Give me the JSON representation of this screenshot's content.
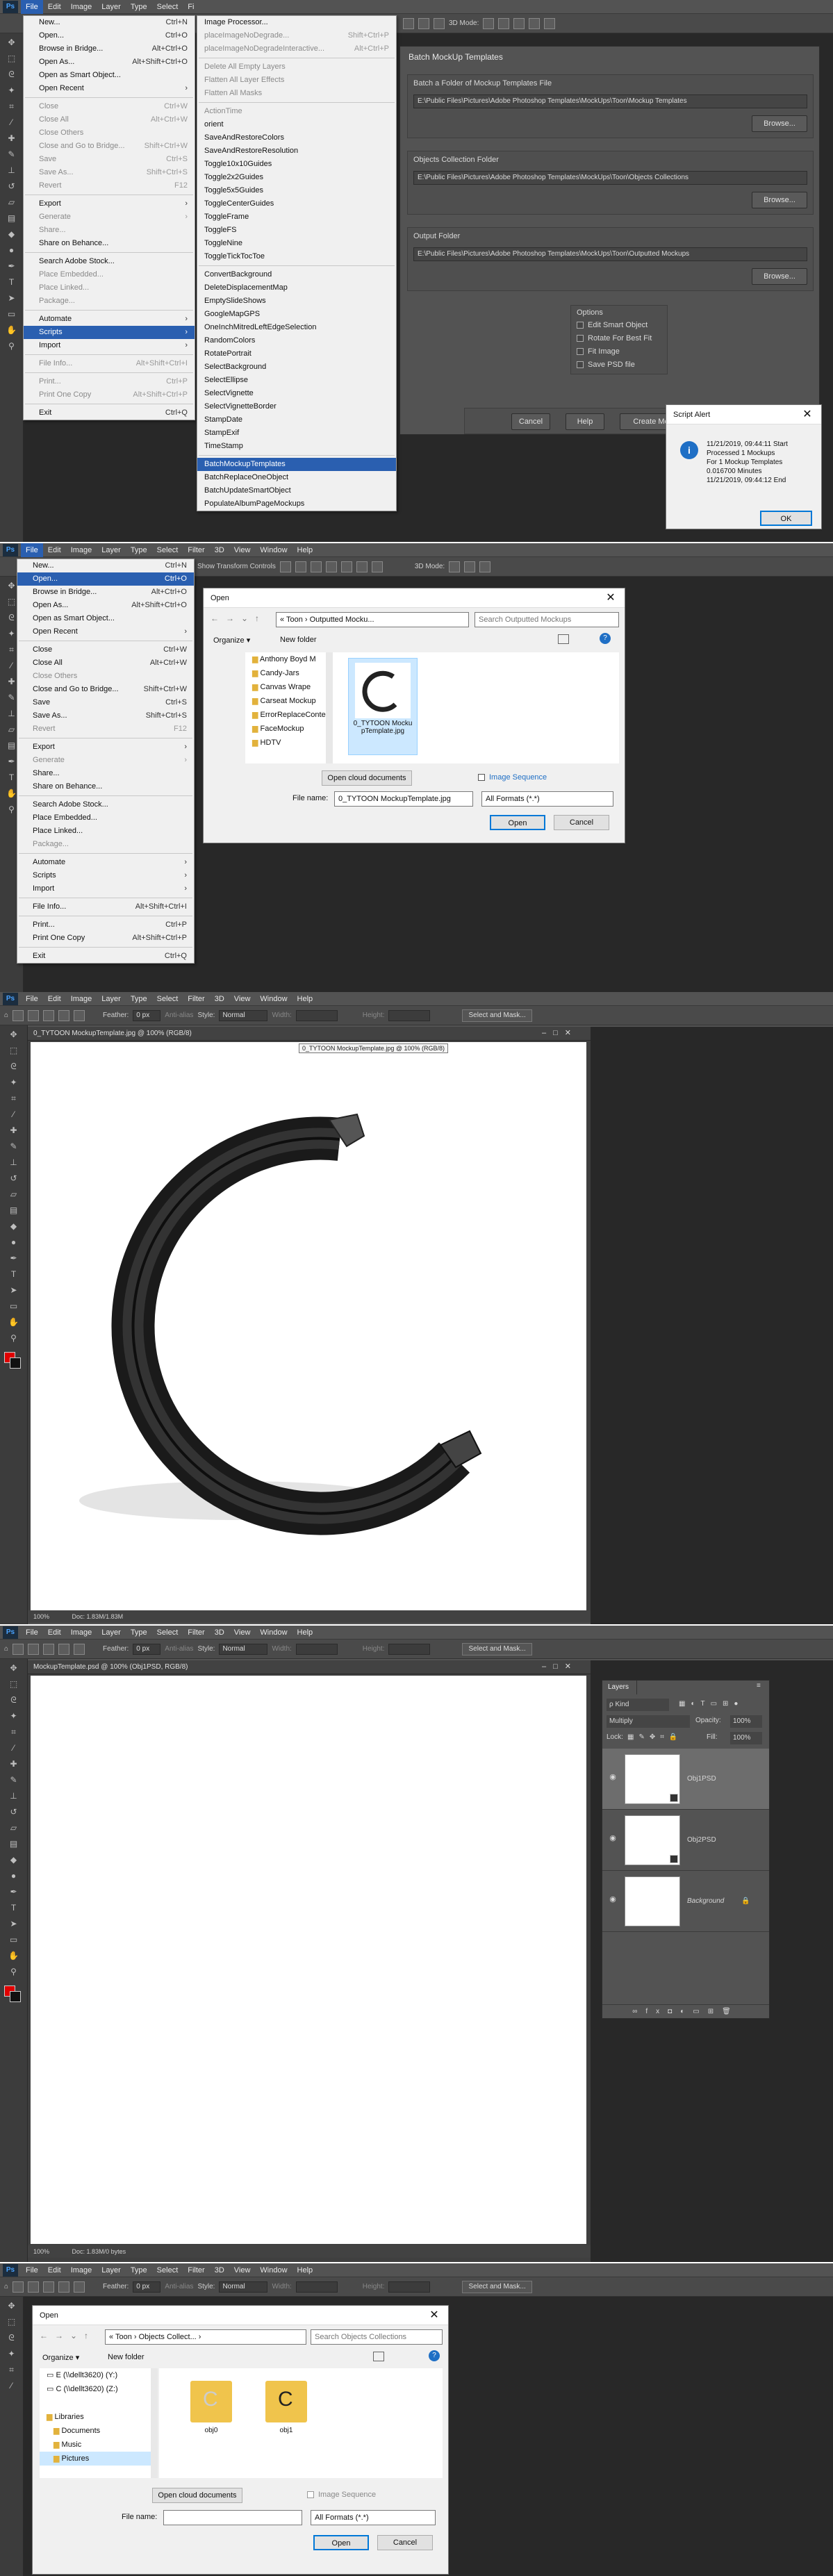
{
  "ps_logo": "Ps",
  "menubar_items": [
    "File",
    "Edit",
    "Image",
    "Layer",
    "Type",
    "Select",
    "Filter",
    "3D",
    "View",
    "Window",
    "Help"
  ],
  "menubar_p1": [
    "File",
    "Edit",
    "Image",
    "Layer",
    "Type",
    "Select",
    "Fi"
  ],
  "file_menu": [
    {
      "label": "New...",
      "sc": "Ctrl+N"
    },
    {
      "label": "Open...",
      "sc": "Ctrl+O"
    },
    {
      "label": "Browse in Bridge...",
      "sc": "Alt+Ctrl+O"
    },
    {
      "label": "Open As...",
      "sc": "Alt+Shift+Ctrl+O"
    },
    {
      "label": "Open as Smart Object...",
      "sc": ""
    },
    {
      "label": "Open Recent",
      "sc": "›"
    },
    {
      "sep": true
    },
    {
      "label": "Close",
      "sc": "Ctrl+W"
    },
    {
      "label": "Close All",
      "sc": "Alt+Ctrl+W"
    },
    {
      "label": "Close Others",
      "sc": ""
    },
    {
      "label": "Close and Go to Bridge...",
      "sc": "Shift+Ctrl+W"
    },
    {
      "label": "Save",
      "sc": "Ctrl+S"
    },
    {
      "label": "Save As...",
      "sc": "Shift+Ctrl+S"
    },
    {
      "label": "Revert",
      "sc": "F12"
    },
    {
      "sep": true
    },
    {
      "label": "Export",
      "sc": "›"
    },
    {
      "label": "Generate",
      "sc": "›"
    },
    {
      "label": "Share...",
      "sc": ""
    },
    {
      "label": "Share on Behance...",
      "sc": ""
    },
    {
      "sep": true
    },
    {
      "label": "Search Adobe Stock...",
      "sc": ""
    },
    {
      "label": "Place Embedded...",
      "sc": ""
    },
    {
      "label": "Place Linked...",
      "sc": ""
    },
    {
      "label": "Package...",
      "sc": ""
    },
    {
      "sep": true
    },
    {
      "label": "Automate",
      "sc": "›"
    },
    {
      "label": "Scripts",
      "sc": "›"
    },
    {
      "label": "Import",
      "sc": "›"
    },
    {
      "sep": true
    },
    {
      "label": "File Info...",
      "sc": "Alt+Shift+Ctrl+I"
    },
    {
      "sep": true
    },
    {
      "label": "Print...",
      "sc": "Ctrl+P"
    },
    {
      "label": "Print One Copy",
      "sc": "Alt+Shift+Ctrl+P"
    },
    {
      "sep": true
    },
    {
      "label": "Exit",
      "sc": "Ctrl+Q"
    }
  ],
  "scripts_menu": [
    "Image Processor...",
    "placeImageNoDegrade...",
    "placeImageNoDegradeInteractive...",
    "Delete All Empty Layers",
    "Flatten All Layer Effects",
    "Flatten All Masks",
    "ActionTime",
    "orient",
    "SaveAndRestoreColors",
    "SaveAndRestoreResolution",
    "Toggle10x10Guides",
    "Toggle2x2Guides",
    "Toggle5x5Guides",
    "ToggleCenterGuides",
    "ToggleFrame",
    "ToggleFS",
    "ToggleNine",
    "ToggleTickTocToe",
    "ConvertBackground",
    "DeleteDisplacementMap",
    "EmptySlideShows",
    "GoogleMapGPS",
    "OneInchMitredLeftEdgeSelection",
    "RandomColors",
    "RotatePortrait",
    "SelectBackground",
    "SelectEllipse",
    "SelectVignette",
    "SelectVignetteBorder",
    "StampDate",
    "StampExif",
    "TimeStamp",
    "BatchMockupTemplates",
    "BatchReplaceOneObject",
    "BatchUpdateSmartObject",
    "PopulateAlbumPageMockups"
  ],
  "scripts_sc": [
    "",
    "Shift+Ctrl+P",
    "Alt+Ctrl+P"
  ],
  "batch_dialog": {
    "title": "Batch MockUp Templates",
    "g1_label": "Batch a Folder of Mockup Templates File",
    "g1_path": "E:\\Public Files\\Pictures\\Adobe Photoshop Templates\\MockUps\\Toon\\Mockup Templates",
    "g2_label": "Objects Collection Folder",
    "g2_path": "E:\\Public Files\\Pictures\\Adobe Photoshop Templates\\MockUps\\Toon\\Objects Collections",
    "g3_label": "Output Folder",
    "g3_path": "E:\\Public Files\\Pictures\\Adobe Photoshop Templates\\MockUps\\Toon\\Outputted Mockups",
    "browse": "Browse...",
    "options_label": "Options",
    "opts": [
      "Edit Smart Object",
      "Rotate For Best Fit",
      "Fit Image",
      "Save PSD file"
    ],
    "cancel": "Cancel",
    "help": "Help",
    "create": "Create Mo"
  },
  "alert": {
    "title": "Script Alert",
    "lines": [
      "11/21/2019, 09:44:11 Start",
      "Processed 1 Mockups",
      "For 1 Mockup Templates",
      "0.016700 Minutes",
      "11/21/2019, 09:44:12  End"
    ],
    "ok": "OK"
  },
  "p1_opt": "3D Mode:",
  "p2_opt": "Show Transform Controls",
  "open1": {
    "title": "Open",
    "crumbs": "«  Toon  ›  Outputted Mocku...",
    "search": "Search Outputted Mockups",
    "organize": "Organize ▾",
    "newfolder": "New folder",
    "folders": [
      "Anthony Boyd  M",
      "Candy-Jars",
      "Canvas Wrape",
      "Carseat Mockup",
      "ErrorReplaceConte",
      "FaceMockup",
      "HDTV"
    ],
    "file": "0_TYTOON MockupTemplate.jpg",
    "cloud": "Open cloud documents",
    "seq": "Image Sequence",
    "fname_label": "File name:",
    "fname": "0_TYTOON MockupTemplate.jpg",
    "ftype": "All Formats (*.*)",
    "open": "Open",
    "cancel": "Cancel"
  },
  "p3": {
    "opt": {
      "feather": "Feather:",
      "fval": "0 px",
      "aa": "Anti-alias",
      "style": "Style:",
      "sval": "Normal",
      "width": "Width:",
      "height": "Height:",
      "mask": "Select and Mask..."
    },
    "tab": "0_TYTOON MockupTemplate.jpg @ 100% (RGB/8)",
    "tooltip": "0_TYTOON MockupTemplate.jpg @ 100% (RGB/8)",
    "zoom": "100%",
    "doc": "Doc: 1.83M/1.83M"
  },
  "p4": {
    "tab": "MockupTemplate.psd @ 100% (Obj1PSD, RGB/8)",
    "zoom": "100%",
    "doc": "Doc: 1.83M/0 bytes",
    "layers_title": "Layers",
    "kind": "ρ Kind",
    "blend": "Multiply",
    "opacity_label": "Opacity:",
    "opacity": "100%",
    "lock": "Lock:",
    "fill_label": "Fill:",
    "fill": "100%",
    "layers": [
      "Obj1PSD",
      "Obj2PSD",
      "Background"
    ]
  },
  "open2": {
    "title": "Open",
    "crumbs": "«  Toon  ›  Objects Collect...  ›",
    "search": "Search Objects Collections",
    "organize": "Organize ▾",
    "newfolder": "New folder",
    "nav": [
      "E (\\\\dellt3620) (Y:)",
      "C (\\\\dellt3620) (Z:)",
      "",
      "Libraries",
      "Documents",
      "Music",
      "Pictures"
    ],
    "files": [
      "obj0",
      "obj1"
    ],
    "cloud": "Open cloud documents",
    "seq": "Image Sequence",
    "fname_label": "File name:",
    "fname": "",
    "ftype": "All Formats (*.*)",
    "open": "Open",
    "cancel": "Cancel"
  }
}
